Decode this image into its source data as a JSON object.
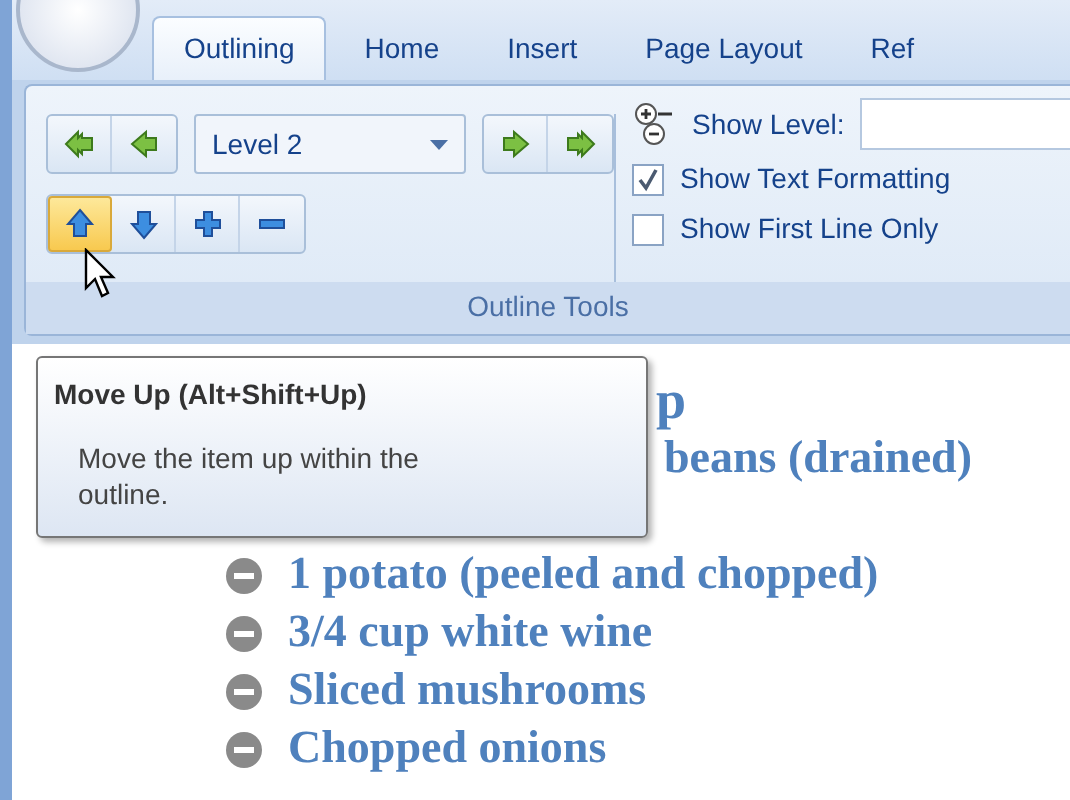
{
  "tabs": [
    {
      "label": "Outlining",
      "selected": true
    },
    {
      "label": "Home",
      "selected": false
    },
    {
      "label": "Insert",
      "selected": false
    },
    {
      "label": "Page Layout",
      "selected": false
    },
    {
      "label": "Ref",
      "selected": false
    }
  ],
  "level_buttons_left": [
    {
      "kind": "double-left"
    },
    {
      "kind": "left"
    }
  ],
  "level_dropdown": {
    "value": "Level 2"
  },
  "level_buttons_right": [
    {
      "kind": "right"
    },
    {
      "kind": "double-right"
    }
  ],
  "move_buttons": [
    {
      "kind": "up",
      "highlighted": true
    },
    {
      "kind": "down",
      "highlighted": false
    },
    {
      "kind": "plus",
      "highlighted": false
    },
    {
      "kind": "minus",
      "highlighted": false
    }
  ],
  "show_level": {
    "label": "Show Level:"
  },
  "options": [
    {
      "label": "Show Text Formatting",
      "checked": true
    },
    {
      "label": "Show First Line Only",
      "checked": false
    }
  ],
  "group_label": "Outline Tools",
  "tooltip": {
    "title": "Move Up (Alt+Shift+Up)",
    "description": "Move the item up within the outline."
  },
  "document": {
    "lines": [
      {
        "kind": "heading",
        "text": "p"
      },
      {
        "kind": "covered",
        "text": "beans (drained)"
      },
      {
        "kind": "bullet",
        "text": "1 potato (peeled and chopped)"
      },
      {
        "kind": "bullet",
        "text": "3/4 cup white wine"
      },
      {
        "kind": "bullet",
        "text": "Sliced mushrooms"
      },
      {
        "kind": "bullet",
        "text": "Chopped onions"
      }
    ]
  }
}
